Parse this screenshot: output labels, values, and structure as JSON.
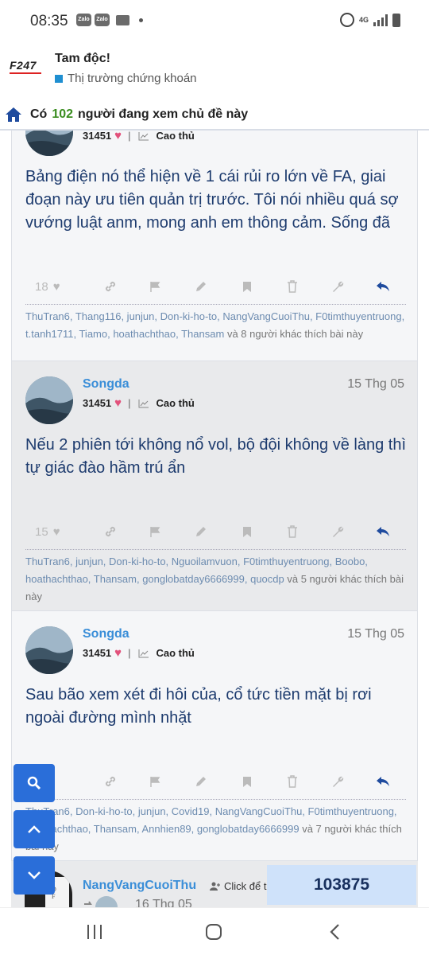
{
  "status_bar": {
    "time": "08:35",
    "zalo1": "Zalo",
    "zalo2": "Zalo",
    "network": "4G"
  },
  "header": {
    "logo_text": "F247",
    "title": "Tam độc!",
    "subtitle": "Thị trường chứng khoán"
  },
  "viewers": {
    "prefix": "Có",
    "count": "102",
    "suffix": "người đang xem chủ đề này"
  },
  "posts": [
    {
      "points": "31451",
      "rank": "Cao thủ",
      "body": "Bảng điện nó thể hiện về 1 cái rủi ro lớn về FA, giai đoạn này ưu tiên quản trị trước. Tôi nói nhiều quá sợ vướng luật anm, mong anh em thông cảm. Sống đã",
      "likes_count": "18",
      "likers": "ThuTran6, Thang116, junjun, Don-ki-ho-to, NangVangCuoiThu, F0timthuyentruong, t.tanh1711, Tiamo, hoathachthao, Thansam",
      "likers_tail": "và 8 người khác thích bài này"
    },
    {
      "username": "Songda",
      "date": "15 Thg 05",
      "points": "31451",
      "rank": "Cao thủ",
      "body": "Nếu 2 phiên tới không nổ vol, bộ đội không về làng thì tự giác đào hầm trú ẩn",
      "likes_count": "15",
      "likers": "ThuTran6, junjun, Don-ki-ho-to, Nguoilamvuon, F0timthuyentruong, Boobo, hoathachthao, Thansam, gonglobatday6666999, quocdp",
      "likers_tail": "và 5 người khác thích bài này"
    },
    {
      "username": "Songda",
      "date": "15 Thg 05",
      "points": "31451",
      "rank": "Cao thủ",
      "body": "Sau bão xem xét đi hôi của, cổ tức tiền mặt bị rơi ngoài đường mình nhặt",
      "likers": "ThuTran6, Don-ki-ho-to, junjun, Covid19, NangVangCuoiThu, F0timthuyentruong, hoathachthao, Thansam, Annhien89, gonglobatday6666999",
      "likers_tail": "và 7 người khác thích bài này"
    }
  ],
  "next_post": {
    "username": "NangVangCuoiThu",
    "follow_label": "Click để t",
    "date": "16 Thg 05"
  },
  "counter": "103875",
  "colors": {
    "accent": "#2a6ed9",
    "username": "#3a8ed8",
    "body_text": "#1d3b6e",
    "viewer_count": "#3a8d1f"
  }
}
